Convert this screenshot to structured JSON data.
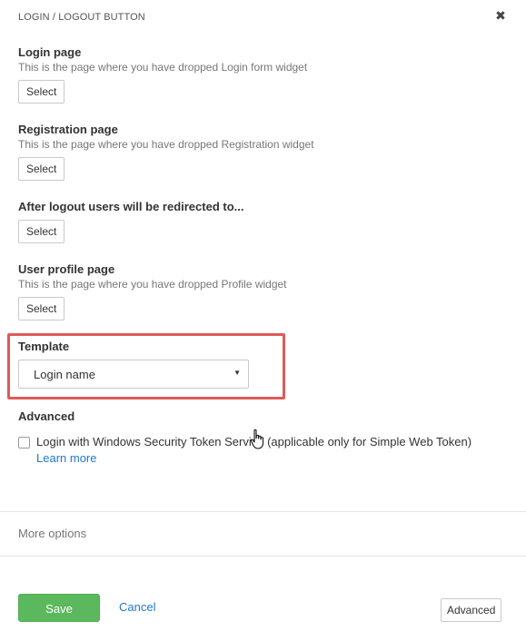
{
  "header": {
    "title": "LOGIN / LOGOUT BUTTON",
    "close_icon": "close-icon"
  },
  "fields": {
    "login_page": {
      "label": "Login page",
      "description": "This is the page where you have dropped Login form widget",
      "button": "Select"
    },
    "registration_page": {
      "label": "Registration page",
      "description": "This is the page where you have dropped Registration widget",
      "button": "Select"
    },
    "logout_redirect": {
      "label": "After logout users will be redirected to...",
      "button": "Select"
    },
    "profile_page": {
      "label": "User profile page",
      "description": "This is the page where you have dropped Profile widget",
      "button": "Select"
    }
  },
  "template": {
    "label": "Template",
    "selected": "Login name"
  },
  "advanced": {
    "label": "Advanced",
    "checkbox_label": "Login with Windows Security Token Service (applicable only for Simple Web Token)",
    "checked": false,
    "learn_more": "Learn more"
  },
  "more_options": "More options",
  "footer": {
    "save": "Save",
    "cancel": "Cancel",
    "advanced": "Advanced"
  },
  "colors": {
    "accent_link": "#1f7ad1",
    "save_button": "#5cb85c",
    "highlight": "#e05a5a"
  }
}
